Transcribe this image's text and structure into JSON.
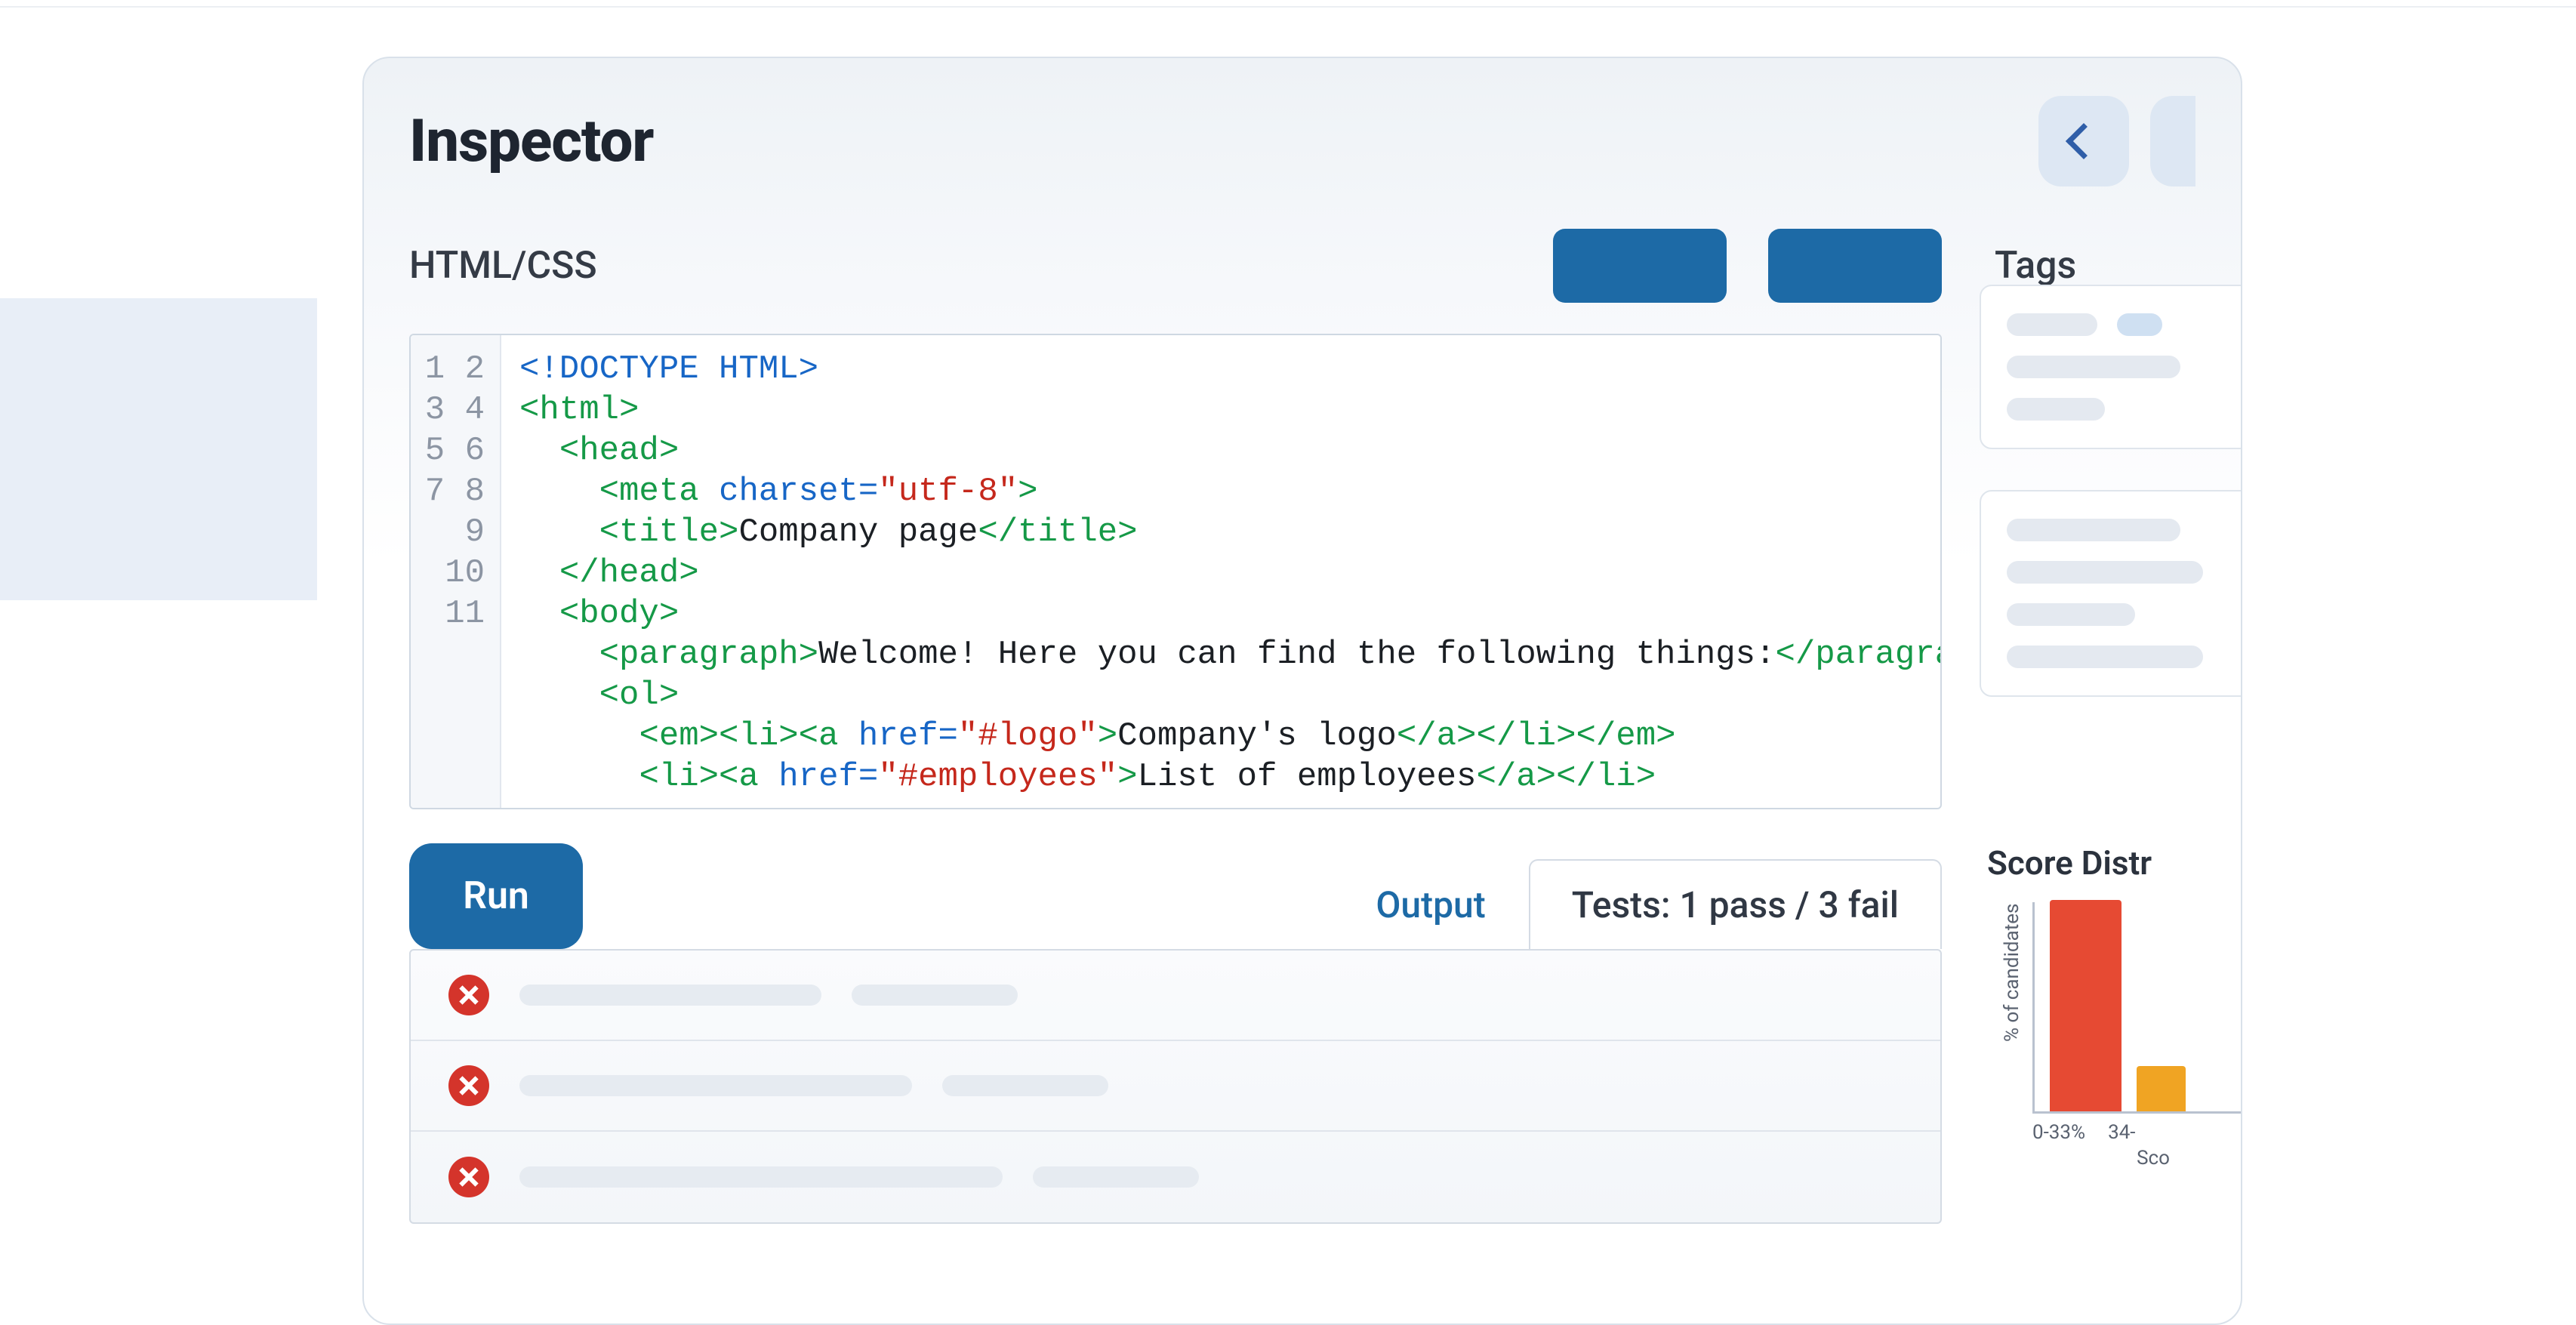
{
  "panel": {
    "title": "Inspector",
    "language_label": "HTML/CSS",
    "tags_label": "Tags"
  },
  "editor": {
    "line_numbers": [
      "1",
      "2",
      "3",
      "4",
      "5",
      "6",
      "7",
      "8",
      "9",
      "10",
      "11"
    ],
    "lines": [
      [
        {
          "cls": "tk-doctype",
          "t": "<!DOCTYPE HTML>"
        }
      ],
      [
        {
          "cls": "tk-tag",
          "t": "<html>"
        }
      ],
      [
        {
          "cls": "",
          "t": "  "
        },
        {
          "cls": "tk-tag",
          "t": "<head>"
        }
      ],
      [
        {
          "cls": "",
          "t": "    "
        },
        {
          "cls": "tk-tag",
          "t": "<meta "
        },
        {
          "cls": "tk-attr",
          "t": "charset="
        },
        {
          "cls": "tk-str",
          "t": "\"utf-8\""
        },
        {
          "cls": "tk-tag",
          "t": ">"
        }
      ],
      [
        {
          "cls": "",
          "t": "    "
        },
        {
          "cls": "tk-tag",
          "t": "<title>"
        },
        {
          "cls": "tk-txt",
          "t": "Company page"
        },
        {
          "cls": "tk-tag",
          "t": "</title>"
        }
      ],
      [
        {
          "cls": "",
          "t": "  "
        },
        {
          "cls": "tk-tag",
          "t": "</head>"
        }
      ],
      [
        {
          "cls": "",
          "t": "  "
        },
        {
          "cls": "tk-tag",
          "t": "<body>"
        }
      ],
      [
        {
          "cls": "",
          "t": "    "
        },
        {
          "cls": "tk-tag",
          "t": "<paragraph>"
        },
        {
          "cls": "tk-txt",
          "t": "Welcome! Here you can find the following things:"
        },
        {
          "cls": "tk-tag",
          "t": "</paragraph>"
        }
      ],
      [
        {
          "cls": "",
          "t": "    "
        },
        {
          "cls": "tk-tag",
          "t": "<ol>"
        }
      ],
      [
        {
          "cls": "",
          "t": "      "
        },
        {
          "cls": "tk-tag",
          "t": "<em><li><a "
        },
        {
          "cls": "tk-attr",
          "t": "href="
        },
        {
          "cls": "tk-str",
          "t": "\"#logo\""
        },
        {
          "cls": "tk-tag",
          "t": ">"
        },
        {
          "cls": "tk-txt",
          "t": "Company's logo"
        },
        {
          "cls": "tk-tag",
          "t": "</a></li></em>"
        }
      ],
      [
        {
          "cls": "",
          "t": "      "
        },
        {
          "cls": "tk-tag",
          "t": "<li><a "
        },
        {
          "cls": "tk-attr",
          "t": "href="
        },
        {
          "cls": "tk-str",
          "t": "\"#employees\""
        },
        {
          "cls": "tk-tag",
          "t": ">"
        },
        {
          "cls": "tk-txt",
          "t": "List of employees"
        },
        {
          "cls": "tk-tag",
          "t": "</a></li>"
        }
      ]
    ]
  },
  "controls": {
    "run_label": "Run",
    "tabs": {
      "output": "Output",
      "tests": "Tests: 1 pass / 3 fail"
    }
  },
  "results": {
    "rows": 3
  },
  "chart_data": {
    "type": "bar",
    "title": "Score Distr",
    "ylabel": "% of candidates",
    "xlabel": "Sco",
    "categories": [
      "0-33%",
      "34-"
    ],
    "values": [
      90,
      20
    ],
    "ylim": [
      0,
      100
    ],
    "colors": [
      "#e64a33",
      "#f0a423"
    ]
  }
}
